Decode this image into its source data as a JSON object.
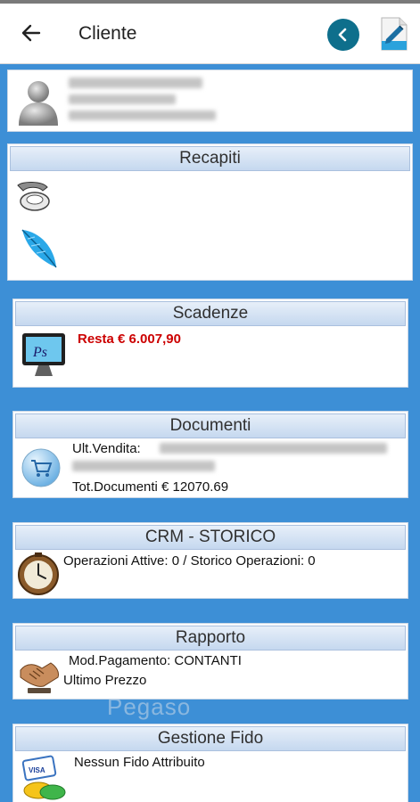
{
  "appbar": {
    "title": "Cliente",
    "back_icon": "arrow-left-icon",
    "nav_icon": "chevron-left-circle-icon",
    "edit_icon": "document-edit-icon"
  },
  "profile": {
    "icon": "user-avatar-icon"
  },
  "recapiti": {
    "header": "Recapiti",
    "icons": [
      "telephone-icon",
      "feather-quill-icon"
    ]
  },
  "scadenze": {
    "header": "Scadenze",
    "resta": "Resta € 6.007,90",
    "icon": "ps-monitor-icon"
  },
  "documenti": {
    "header": "Documenti",
    "ult_vendita_label": "Ult.Vendita:",
    "tot_documenti": "Tot.Documenti €  12070.69",
    "icon": "shopping-cart-icon"
  },
  "crm": {
    "header": "CRM - STORICO",
    "operazioni": "Operazioni Attive: 0 / Storico Operazioni: 0",
    "icon": "clock-icon"
  },
  "rapporto": {
    "header": "Rapporto",
    "pagamento": "Mod.Pagamento: CONTANTI",
    "ultimo_prezzo": "Ultimo Prezzo",
    "icon": "handshake-icon"
  },
  "fido": {
    "header": "Gestione Fido",
    "nessun_fido": "Nessun Fido Attribuito",
    "icon": "credit-card-icon"
  },
  "watermark": "Pegaso",
  "colors": {
    "background": "#3d8fd6",
    "accent": "#0e6f8c",
    "resta": "#cc0000"
  }
}
